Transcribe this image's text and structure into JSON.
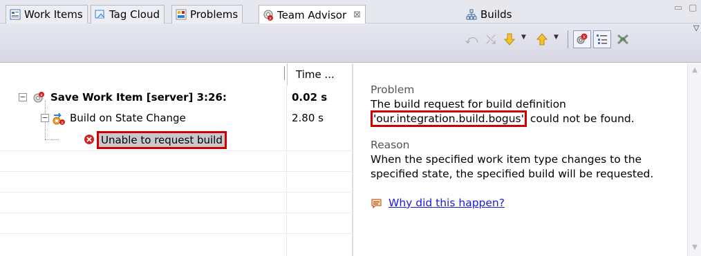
{
  "tabs": [
    {
      "label": "Work Items"
    },
    {
      "label": "Tag Cloud"
    },
    {
      "label": "Problems"
    },
    {
      "label": "Team Advisor",
      "close": "⊠"
    },
    {
      "label": "Builds"
    }
  ],
  "window_controls": {
    "minimize": "▭",
    "maximize": "▢"
  },
  "tree": {
    "columns": {
      "col2": "Time ..."
    },
    "rows": [
      {
        "label": "Save Work Item [server] 3:26:",
        "time": "0.02 s"
      },
      {
        "label": "Build on State Change",
        "time": "2.80 s"
      },
      {
        "label": "Unable to request build",
        "time": ""
      }
    ]
  },
  "detail": {
    "problem_heading": "Problem",
    "problem_line1": "The build request for build definition",
    "problem_id": "'our.integration.build.bogus'",
    "problem_suffix": " could not be found.",
    "reason_heading": "Reason",
    "reason_text": "When the specified work item type changes to the specified state, the specified build will be requested.",
    "link": "Why did this happen?"
  },
  "colors": {
    "selection_outline": "#cc0000",
    "link": "#1a1ae0",
    "error": "#d42020"
  }
}
